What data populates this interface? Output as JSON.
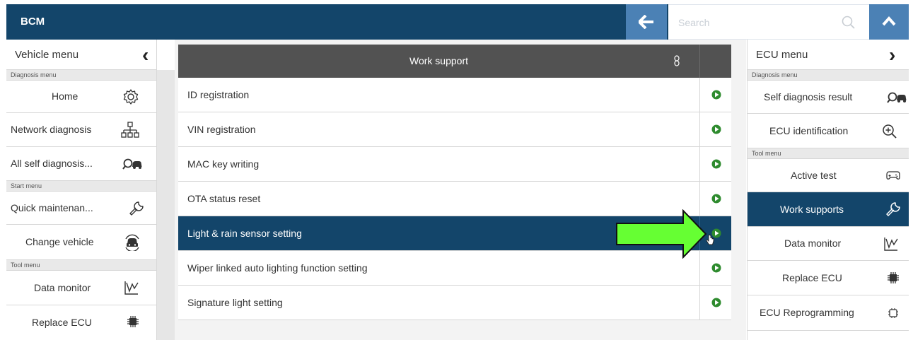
{
  "app": {
    "title": "BCM"
  },
  "search": {
    "placeholder": "Search"
  },
  "left_panel": {
    "header": "Vehicle menu",
    "sections": {
      "diagnosis": "Diagnosis menu",
      "start": "Start menu",
      "tool": "Tool menu"
    },
    "items": {
      "home": "Home",
      "network": "Network diagnosis",
      "all_self": "All self diagnosis...",
      "quick": "Quick maintenan...",
      "change": "Change vehicle",
      "data_monitor": "Data monitor",
      "replace_ecu": "Replace ECU"
    }
  },
  "main": {
    "title": "Work support",
    "rows": [
      "ID registration",
      "VIN registration",
      "MAC key writing",
      "OTA status reset",
      "Light & rain sensor setting",
      "Wiper linked auto lighting function setting",
      "Signature light setting"
    ],
    "selected_row": "Light & rain sensor setting"
  },
  "right_panel": {
    "header": "ECU menu",
    "sections": {
      "diagnosis": "Diagnosis menu",
      "tool": "Tool menu"
    },
    "items": {
      "self_diag": "Self diagnosis result",
      "ecu_id": "ECU identification",
      "active_test": "Active test",
      "work_supports": "Work supports",
      "data_monitor": "Data monitor",
      "replace_ecu": "Replace ECU",
      "reprogramming": "ECU Reprogramming"
    },
    "selected_item": "Work supports"
  },
  "colors": {
    "topbar": "#13456a",
    "accent_button": "#4b81b5",
    "selected": "#13456a",
    "play_icon": "#2e8b2e",
    "annotation_arrow": "#66ff33"
  }
}
